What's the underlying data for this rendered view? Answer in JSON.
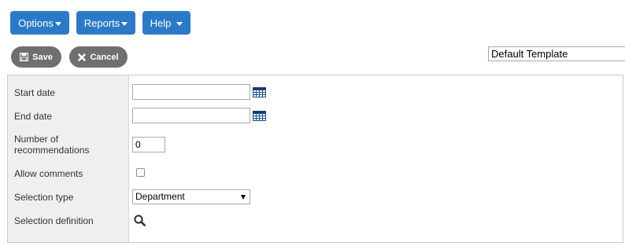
{
  "menu": {
    "options_label": "Options",
    "reports_label": "Reports",
    "help_label": "Help"
  },
  "actions": {
    "save_label": "Save",
    "cancel_label": "Cancel"
  },
  "template": {
    "selected": "Default Template"
  },
  "form": {
    "start_date": {
      "label": "Start date",
      "value": ""
    },
    "end_date": {
      "label": "End date",
      "value": ""
    },
    "num_recommendations": {
      "label_line1": "Number of",
      "label_line2": "recommendations",
      "value": "0"
    },
    "allow_comments": {
      "label": "Allow comments",
      "checked": false
    },
    "selection_type": {
      "label": "Selection type",
      "selected": "Department"
    },
    "selection_definition": {
      "label": "Selection definition"
    }
  },
  "colors": {
    "primary_button": "#2b7ac9",
    "action_button": "#6f6f6f",
    "label_column": "#efefef",
    "calendar_icon": "#1f4f8f"
  },
  "icons": {
    "menu_caret": "caret-down-icon",
    "save": "floppy-disk-icon",
    "cancel": "x-icon",
    "date_picker": "calendar-icon",
    "selection_definition": "magnifier-icon"
  }
}
